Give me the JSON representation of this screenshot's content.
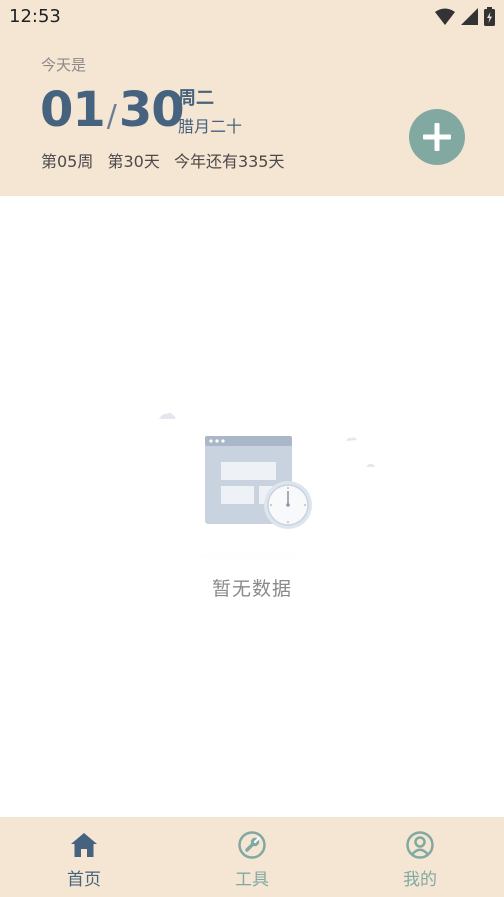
{
  "status_bar": {
    "time": "12:53"
  },
  "header": {
    "today_label": "今天是",
    "month": "01",
    "separator": "/",
    "day": "30",
    "weekday": "周二",
    "lunar_date": "腊月二十",
    "week_number": "第05周",
    "day_of_year": "第30天",
    "days_remaining": "今年还有335天"
  },
  "empty_state": {
    "message": "暂无数据"
  },
  "nav": {
    "items": [
      {
        "label": "首页",
        "icon": "home-icon",
        "active": true
      },
      {
        "label": "工具",
        "icon": "wrench-icon",
        "active": false
      },
      {
        "label": "我的",
        "icon": "profile-icon",
        "active": false
      }
    ]
  },
  "colors": {
    "header_bg": "#f5e6d3",
    "accent": "#45627f",
    "teal": "#82a9a1",
    "muted_text": "#8a8a8a"
  }
}
